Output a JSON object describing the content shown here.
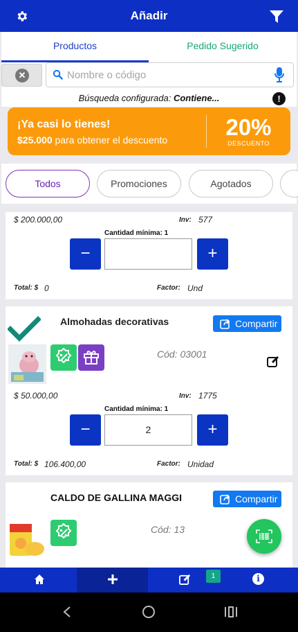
{
  "header": {
    "title": "Añadir",
    "settings_icon": "gear-icon",
    "filter_icon": "filter-icon"
  },
  "tabs": [
    {
      "label": "Productos",
      "active": true
    },
    {
      "label": "Pedido Sugerido",
      "active": false
    }
  ],
  "search": {
    "placeholder": "Nombre o código",
    "value": "",
    "config_prefix": "Búsqueda configurada: ",
    "config_value": "Contiene...",
    "info_glyph": "!"
  },
  "promo": {
    "line1": "¡Ya casi lo tienes!",
    "amount": "$25.000",
    "line2_rest": " para obtener el descuento",
    "percent": "20%",
    "percent_label": "DESCUENTO",
    "color": "#fb9b0c"
  },
  "filters": [
    {
      "label": "Todos",
      "active": true
    },
    {
      "label": "Promociones"
    },
    {
      "label": "Agotados"
    }
  ],
  "products": [
    {
      "price": "$  200.000,00",
      "inv_label": "Inv:",
      "inv": "577",
      "min_label": "Cantidad mínima: 1",
      "qty": "",
      "total_label": "Total: $",
      "total": "0",
      "factor_label": "Factor:",
      "factor": "Und"
    },
    {
      "name": "Almohadas decorativas",
      "share_label": "Compartir",
      "code": "Cód: 03001",
      "price": "$  50.000,00",
      "inv_label": "Inv:",
      "inv": "1775",
      "min_label": "Cantidad mínima: 1",
      "qty": "2",
      "total_label": "Total: $",
      "total": "106.400,00",
      "factor_label": "Factor:",
      "factor": "Unidad"
    },
    {
      "name": "CALDO DE GALLINA MAGGI",
      "share_label": "Compartir",
      "code": "Cód: 13"
    }
  ],
  "qty_buttons": {
    "minus": "−",
    "plus": "+"
  },
  "bottom_nav": {
    "cart_badge": "1"
  },
  "colors": {
    "primary": "#0d2fc4",
    "share": "#1279f0",
    "promo_badge": "#2ecc71",
    "gift_badge": "#7b3fc4",
    "fab": "#22c55e"
  }
}
